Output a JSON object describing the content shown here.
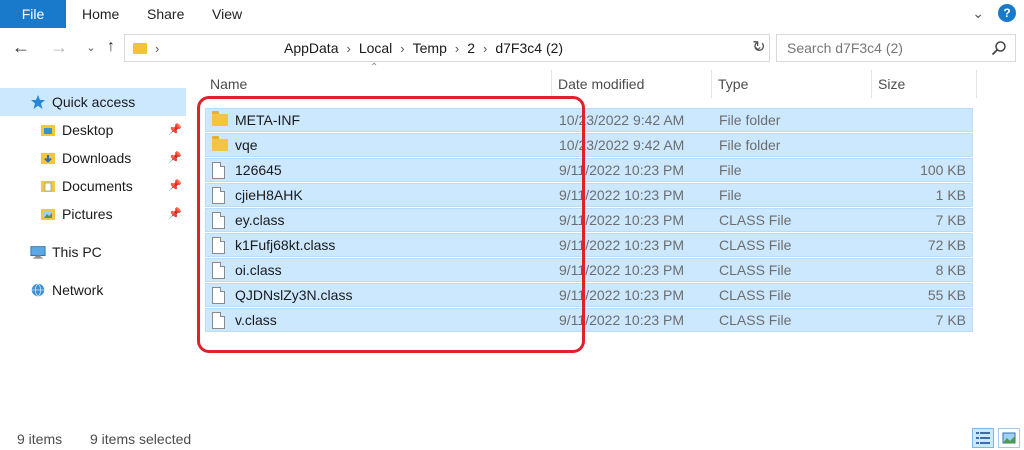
{
  "ribbon": {
    "tabs": [
      "File",
      "Home",
      "Share",
      "View"
    ],
    "help_label": "?"
  },
  "address": {
    "crumbs": [
      "AppData",
      "Local",
      "Temp",
      "2",
      "d7F3c4 (2)"
    ]
  },
  "search": {
    "placeholder": "Search d7F3c4 (2)"
  },
  "sidebar": {
    "items": [
      {
        "label": "Quick access",
        "icon": "star-icon",
        "active": true
      },
      {
        "label": "Desktop",
        "icon": "desktop-folder-icon",
        "pinned": true
      },
      {
        "label": "Downloads",
        "icon": "downloads-folder-icon",
        "pinned": true
      },
      {
        "label": "Documents",
        "icon": "documents-folder-icon",
        "pinned": true
      },
      {
        "label": "Pictures",
        "icon": "pictures-folder-icon",
        "pinned": true
      },
      {
        "label": "This PC",
        "icon": "computer-icon"
      },
      {
        "label": "Network",
        "icon": "network-icon"
      }
    ]
  },
  "columns": {
    "name": "Name",
    "date": "Date modified",
    "type": "Type",
    "size": "Size"
  },
  "files": [
    {
      "name": "META-INF",
      "date": "10/23/2022 9:42 AM",
      "type": "File folder",
      "size": "",
      "kind": "folder"
    },
    {
      "name": "vqe",
      "date": "10/23/2022 9:42 AM",
      "type": "File folder",
      "size": "",
      "kind": "folder"
    },
    {
      "name": "126645",
      "date": "9/11/2022 10:23 PM",
      "type": "File",
      "size": "100 KB",
      "kind": "file"
    },
    {
      "name": "cjieH8AHK",
      "date": "9/11/2022 10:23 PM",
      "type": "File",
      "size": "1 KB",
      "kind": "file"
    },
    {
      "name": "ey.class",
      "date": "9/11/2022 10:23 PM",
      "type": "CLASS File",
      "size": "7 KB",
      "kind": "file"
    },
    {
      "name": "k1Fufj68kt.class",
      "date": "9/11/2022 10:23 PM",
      "type": "CLASS File",
      "size": "72 KB",
      "kind": "file"
    },
    {
      "name": "oi.class",
      "date": "9/11/2022 10:23 PM",
      "type": "CLASS File",
      "size": "8 KB",
      "kind": "file"
    },
    {
      "name": "QJDNslZy3N.class",
      "date": "9/11/2022 10:23 PM",
      "type": "CLASS File",
      "size": "55 KB",
      "kind": "file"
    },
    {
      "name": "v.class",
      "date": "9/11/2022 10:23 PM",
      "type": "CLASS File",
      "size": "7 KB",
      "kind": "file"
    }
  ],
  "status": {
    "count": "9 items",
    "selected": "9 items selected"
  },
  "colors": {
    "accent": "#1979ca",
    "selection": "#cce8ff",
    "highlight": "#e0212b"
  }
}
